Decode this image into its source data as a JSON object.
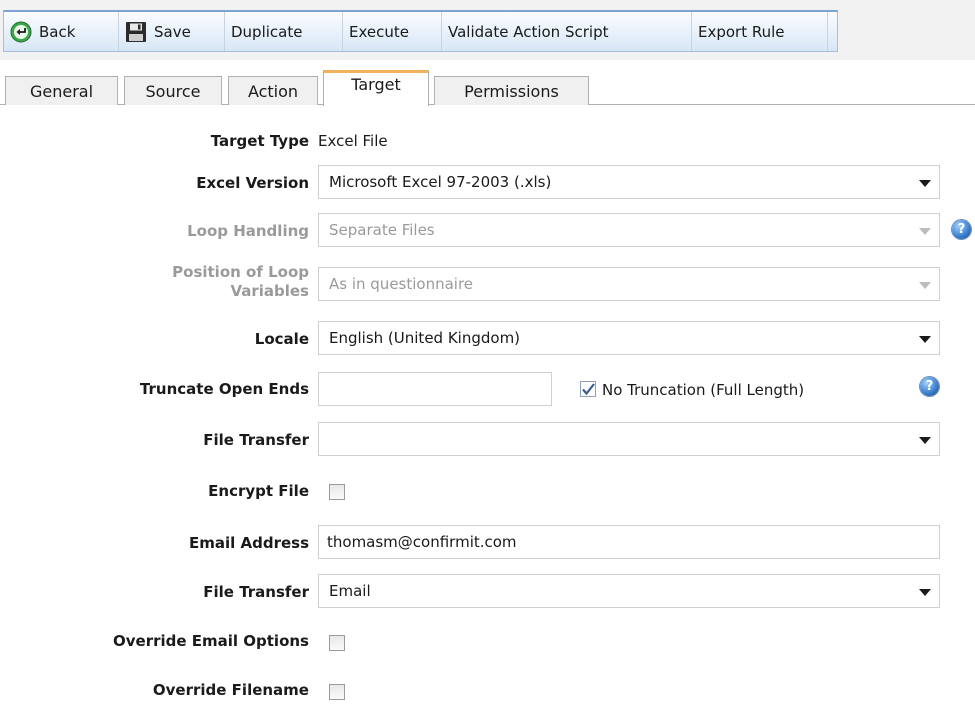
{
  "toolbar": {
    "back_label": "Back",
    "save_label": "Save",
    "duplicate_label": "Duplicate",
    "execute_label": "Execute",
    "validate_label": "Validate Action Script",
    "export_label": "Export Rule"
  },
  "tabs": [
    {
      "label": "General",
      "active": false
    },
    {
      "label": "Source",
      "active": false
    },
    {
      "label": "Action",
      "active": false
    },
    {
      "label": "Target",
      "active": true
    },
    {
      "label": "Permissions",
      "active": false
    }
  ],
  "form": {
    "target_type": {
      "label": "Target Type",
      "value": "Excel File"
    },
    "excel_version": {
      "label": "Excel Version",
      "value": "Microsoft Excel 97-2003 (.xls)"
    },
    "loop_handling": {
      "label": "Loop Handling",
      "value": "Separate Files",
      "disabled": true
    },
    "loop_position": {
      "label_line1": "Position of Loop",
      "label_line2": "Variables",
      "value": "As in questionnaire",
      "disabled": true
    },
    "locale": {
      "label": "Locale",
      "value": "English (United Kingdom)"
    },
    "truncate": {
      "label": "Truncate Open Ends",
      "value": "",
      "checkbox_label": "No Truncation (Full Length)",
      "checked": true
    },
    "file_transfer_1": {
      "label": "File Transfer",
      "value": ""
    },
    "encrypt_file": {
      "label": "Encrypt File",
      "checked": false
    },
    "email_address": {
      "label": "Email Address",
      "value": "thomasm@confirmit.com"
    },
    "file_transfer_2": {
      "label": "File Transfer",
      "value": "Email"
    },
    "override_email": {
      "label": "Override Email Options",
      "checked": false
    },
    "override_filename": {
      "label": "Override Filename",
      "checked": false
    }
  },
  "icons": {
    "help_glyph": "?"
  },
  "colors": {
    "active_tab_accent": "#f0b25c",
    "toolbar_top_border": "#7da3d1",
    "help_icon": "#2a6fc2",
    "disabled_text": "#9a9a9a"
  }
}
